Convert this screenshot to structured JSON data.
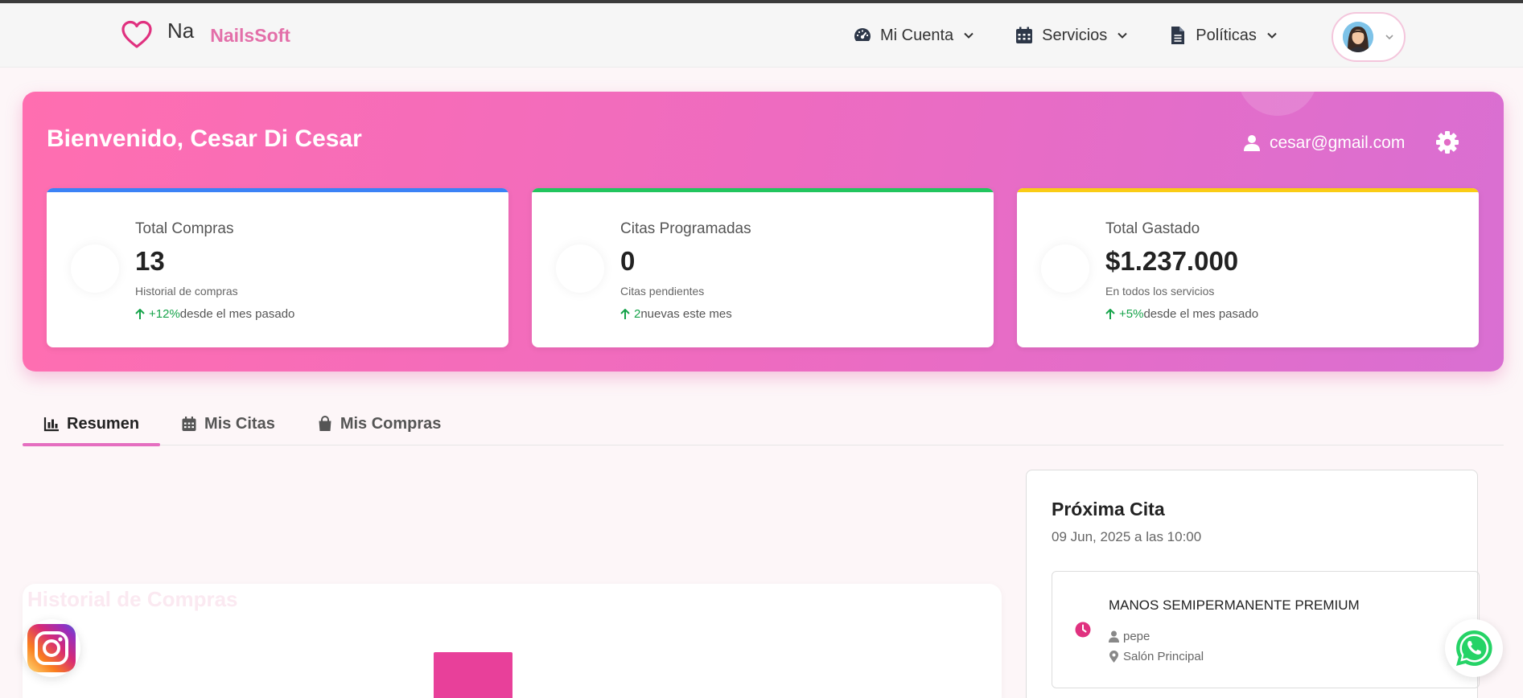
{
  "navbar": {
    "logo_alt": "Na",
    "brand_name": "NailsSoft",
    "menu": [
      {
        "label": "Mi Cuenta",
        "icon": "gauge-icon"
      },
      {
        "label": "Servicios",
        "icon": "calendar-icon"
      },
      {
        "label": "Políticas",
        "icon": "document-icon"
      }
    ]
  },
  "hero": {
    "welcome": "Bienvenido, Cesar Di Cesar",
    "email": "cesar@gmail.com",
    "cards": [
      {
        "label": "Total Compras",
        "value": "13",
        "sub": "Historial de compras",
        "trend_value": "+12%",
        "trend_text": " desde el mes pasado",
        "accent": "#3b82f6"
      },
      {
        "label": "Citas Programadas",
        "value": "0",
        "sub": "Citas pendientes",
        "trend_value": "2",
        "trend_text": " nuevas este mes",
        "accent": "#22c55e"
      },
      {
        "label": "Total Gastado",
        "value": "$1.237.000",
        "sub": "En todos los servicios",
        "trend_value": "+5%",
        "trend_text": " desde el mes pasado",
        "accent": "#facc15"
      }
    ]
  },
  "tabs": [
    {
      "label": "Resumen",
      "icon": "chart-icon"
    },
    {
      "label": "Mis Citas",
      "icon": "calendar-icon"
    },
    {
      "label": "Mis Compras",
      "icon": "bag-icon"
    }
  ],
  "history": {
    "title": "Historial de Compras"
  },
  "next_appointment": {
    "title": "Próxima Cita",
    "date": "09 Jun, 2025 a las 10:00",
    "service": "MANOS SEMIPERMANENTE PREMIUM",
    "staff": "pepe",
    "location": "Salón Principal"
  },
  "colors": {
    "brand": "#e36fa9",
    "accent_pink": "#e8409a"
  }
}
